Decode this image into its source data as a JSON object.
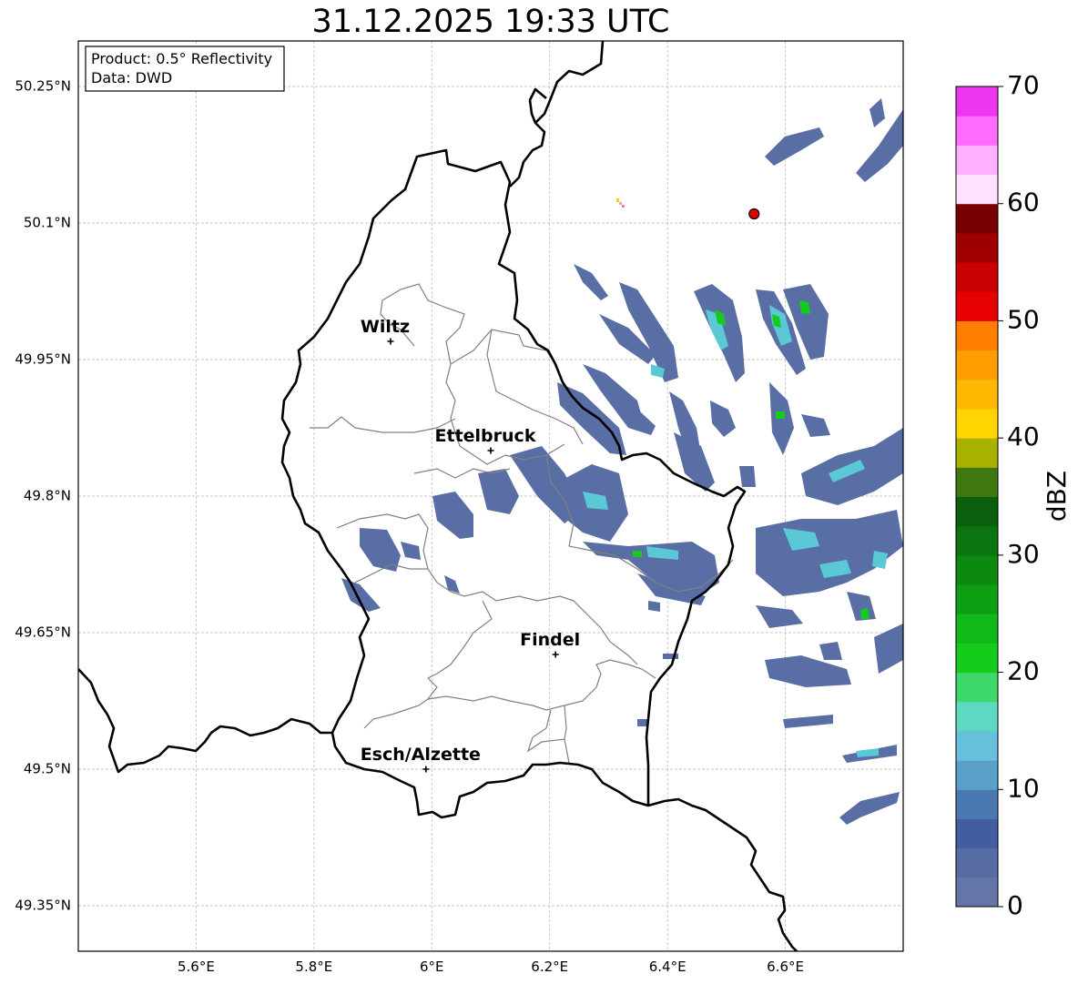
{
  "title": "31.12.2025 19:33 UTC",
  "info_box": {
    "product": "Product: 0.5° Reflectivity",
    "data_source": "Data: DWD"
  },
  "map": {
    "lon_range": [
      5.4,
      6.8
    ],
    "lat_range": [
      49.3,
      50.3
    ],
    "grid": true,
    "lat_ticks": [
      {
        "value": 50.25,
        "label": "50.25°N"
      },
      {
        "value": 50.1,
        "label": "50.1°N"
      },
      {
        "value": 49.95,
        "label": "49.95°N"
      },
      {
        "value": 49.8,
        "label": "49.8°N"
      },
      {
        "value": 49.65,
        "label": "49.65°N"
      },
      {
        "value": 49.5,
        "label": "49.5°N"
      },
      {
        "value": 49.35,
        "label": "49.35°N"
      }
    ],
    "lon_ticks": [
      {
        "value": 5.6,
        "label": "5.6°E"
      },
      {
        "value": 5.8,
        "label": "5.8°E"
      },
      {
        "value": 6.0,
        "label": "6°E"
      },
      {
        "value": 6.2,
        "label": "6.2°E"
      },
      {
        "value": 6.4,
        "label": "6.4°E"
      },
      {
        "value": 6.6,
        "label": "6.6°E"
      }
    ],
    "cities": [
      {
        "name": "Wiltz",
        "lon": 5.93,
        "lat": 49.97
      },
      {
        "name": "Ettelbruck",
        "lon": 6.1,
        "lat": 49.85
      },
      {
        "name": "Findel",
        "lon": 6.21,
        "lat": 49.626
      },
      {
        "name": "Esch/Alzette",
        "lon": 5.99,
        "lat": 49.5
      }
    ],
    "radar_site": {
      "lon": 6.547,
      "lat": 50.11,
      "color": "#e00000"
    }
  },
  "colorbar": {
    "label": "dBZ",
    "min": 0,
    "max": 70,
    "ticks": [
      0,
      10,
      20,
      30,
      40,
      50,
      60,
      70
    ],
    "colors": [
      "#6475a8",
      "#566ca3",
      "#425da0",
      "#4a78b0",
      "#59a0c8",
      "#66c0dc",
      "#5fd8c2",
      "#3ed86a",
      "#14cc1c",
      "#10b818",
      "#0e9e14",
      "#0c8a10",
      "#0a7410",
      "#0a5e0c",
      "#407810",
      "#a8b000",
      "#ffd400",
      "#ffb800",
      "#ff9c00",
      "#ff7e00",
      "#e60000",
      "#c80000",
      "#a00000",
      "#780000",
      "#ffe0ff",
      "#ffb0ff",
      "#ff6cff",
      "#ee36ee"
    ]
  }
}
